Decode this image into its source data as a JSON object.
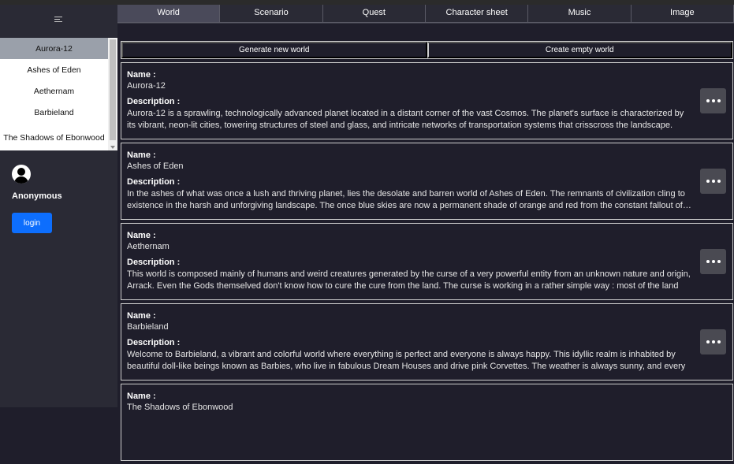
{
  "sidebar": {
    "worlds": [
      "Aurora-12",
      "Ashes of Eden",
      "Aethernam",
      "Barbieland",
      "The Shadows of Ebonwood"
    ],
    "username": "Anonymous",
    "login_label": "login"
  },
  "tabs": [
    "World",
    "Scenario",
    "Quest",
    "Character sheet",
    "Music",
    "Image"
  ],
  "actions": {
    "generate_label": "Generate new world",
    "empty_label": "Create empty world"
  },
  "cards": [
    {
      "name_label": "Name :",
      "name": "Aurora-12",
      "desc_label": "Description :",
      "description": "Aurora-12 is a sprawling, technologically advanced planet located in a distant corner of the vast Cosmos. The planet's surface is characterized by its vibrant, neon-lit cities, towering structures of steel and glass, and intricate networks of transportation systems that crisscross the landscape. The…"
    },
    {
      "name_label": "Name :",
      "name": "Ashes of Eden",
      "desc_label": "Description :",
      "description": "In the ashes of what was once a lush and thriving planet, lies the desolate and barren world of Ashes of Eden. The remnants of civilization cling to existence in the harsh and unforgiving landscape. The once blue skies are now a permanent shade of orange and red from the constant fallout of…"
    },
    {
      "name_label": "Name :",
      "name": "Aethernam",
      "desc_label": "Description :",
      "description": "This world is composed mainly of humans and weird creatures generated by the curse of a very powerful entity from an unknown nature and origin, Arrack. Even the Gods themselved don't know how to cure the cure from the land. The curse is working in a rather simple way : most of the land has…"
    },
    {
      "name_label": "Name :",
      "name": "Barbieland",
      "desc_label": "Description :",
      "description": "Welcome to Barbieland, a vibrant and colorful world where everything is perfect and everyone is always happy. This idyllic realm is inhabited by beautiful doll-like beings known as Barbies, who live in fabulous Dream Houses and drive pink Corvettes. The weather is always sunny, and every day feels like a…"
    },
    {
      "name_label": "Name :",
      "name": "The Shadows of Ebonwood",
      "desc_label": "",
      "description": ""
    }
  ],
  "icons": {
    "menu": "menu-icon",
    "avatar": "user-avatar-icon",
    "more": "more-options-icon"
  },
  "colors": {
    "background": "#1f1e2b",
    "sidebar": "#2a2a35",
    "active_tab": "#4a4a5a",
    "login": "#0d6efd",
    "selected_item": "#9aa0aa"
  }
}
